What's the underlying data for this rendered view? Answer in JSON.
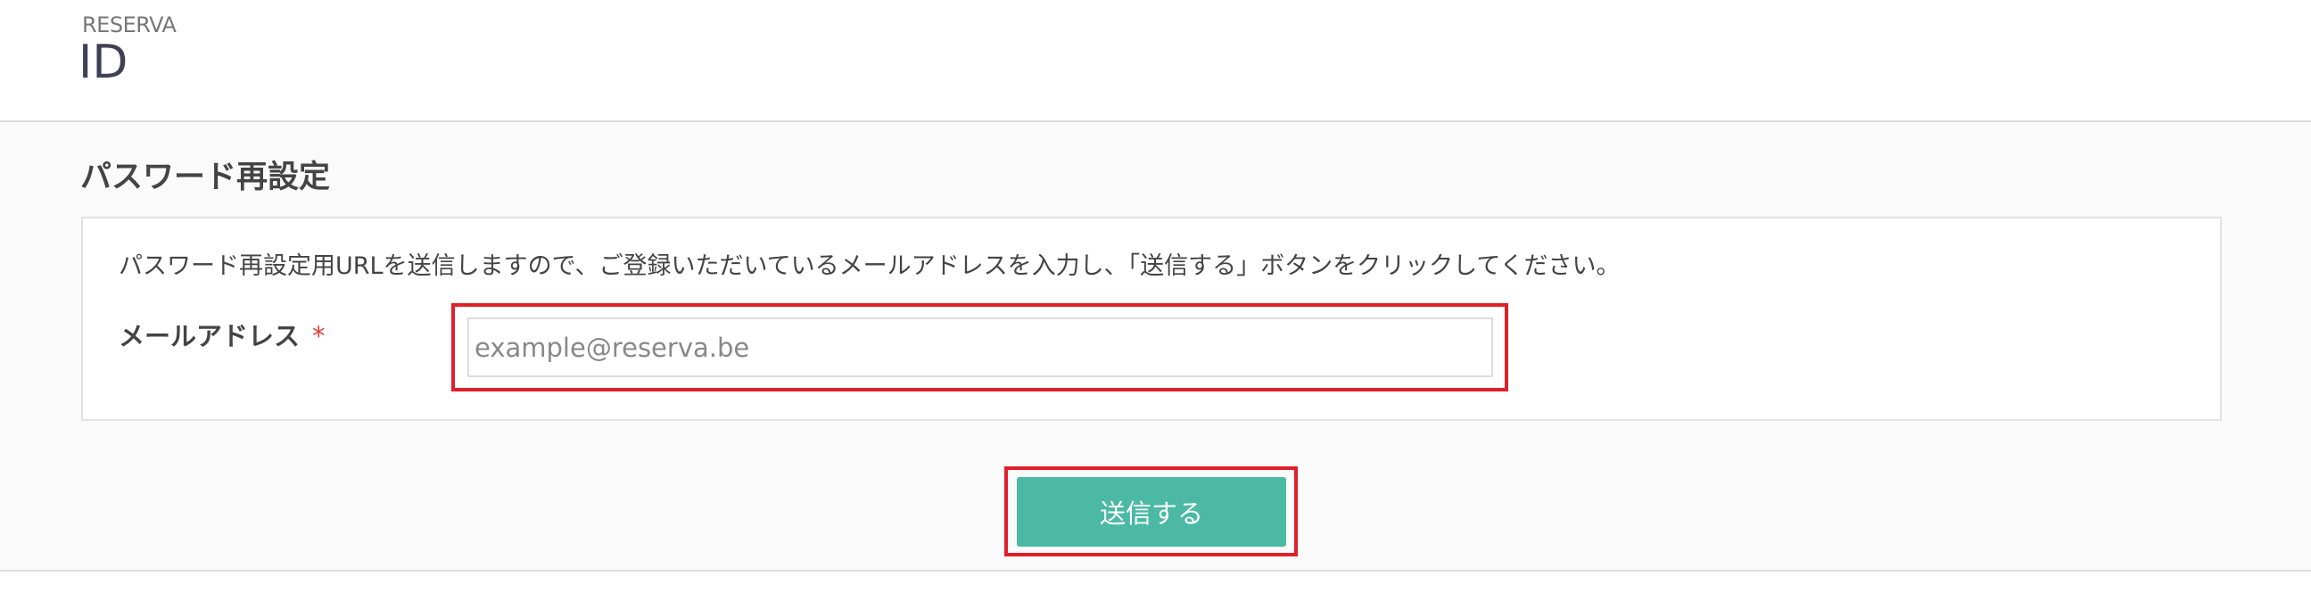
{
  "header": {
    "logo_small": "RESERVA",
    "logo_big": "ID"
  },
  "main": {
    "title": "パスワード再設定",
    "instruction": "パスワード再設定用URLを送信しますので、ご登録いただいているメールアドレスを入力し、「送信する」ボタンをクリックしてください。",
    "email_field": {
      "label": "メールアドレス",
      "required_mark": "*",
      "placeholder": "example@reserva.be",
      "value": ""
    },
    "submit_label": "送信する"
  },
  "colors": {
    "accent_button": "#4bb9a4",
    "highlight_border": "#e01f2a",
    "required_mark": "#e0403c",
    "page_background": "#fafafa"
  }
}
